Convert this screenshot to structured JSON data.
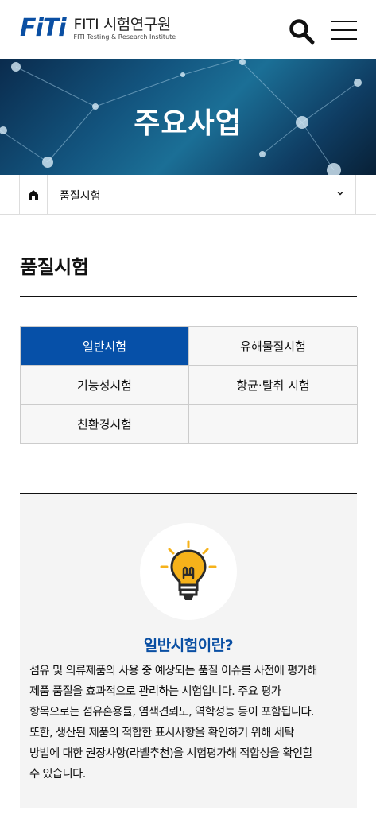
{
  "header": {
    "logo_mark": "FiTi",
    "logo_name": "FITI 시험연구원",
    "logo_subtitle": "FITI Testing & Research Institute",
    "search_icon": "search-icon",
    "menu_icon": "hamburger-menu-icon"
  },
  "banner": {
    "title": "주요사업"
  },
  "breadcrumb": {
    "home_icon": "home-icon",
    "current": "품질시험",
    "chevron_icon": "chevron-down-icon"
  },
  "page": {
    "title": "품질시험"
  },
  "tabs": [
    {
      "label": "일반시험",
      "active": true
    },
    {
      "label": "유해물질시험",
      "active": false
    },
    {
      "label": "기능성시험",
      "active": false
    },
    {
      "label": "항균·탈취 시험",
      "active": false
    },
    {
      "label": "친환경시험",
      "active": false
    }
  ],
  "info": {
    "icon": "lightbulb-icon",
    "title": "일반시험이란?",
    "lines": [
      "섬유 및 의류제품의 사용 중 예상되는 품질 이슈를 사전에 평가해",
      "제품 품질을 효과적으로 관리하는 시험입니다. 주요 평가",
      "항목으로는 섬유혼용률, 염색견뢰도, 역학성능 등이 포함됩니다.",
      "또한, 생산된 제품의 적합한 표시사항을 확인하기 위해 세탁",
      "방법에 대한 권장사항(라벨추천)을 시험평가해 적합성을 확인할",
      "수 있습니다."
    ]
  },
  "colors": {
    "brand_blue": "#0650a8",
    "title_blue": "#0a4fa3",
    "tab_bg": "#f7f7f7",
    "info_bg": "#f4f4f4",
    "bulb_yellow": "#f6b21a"
  }
}
